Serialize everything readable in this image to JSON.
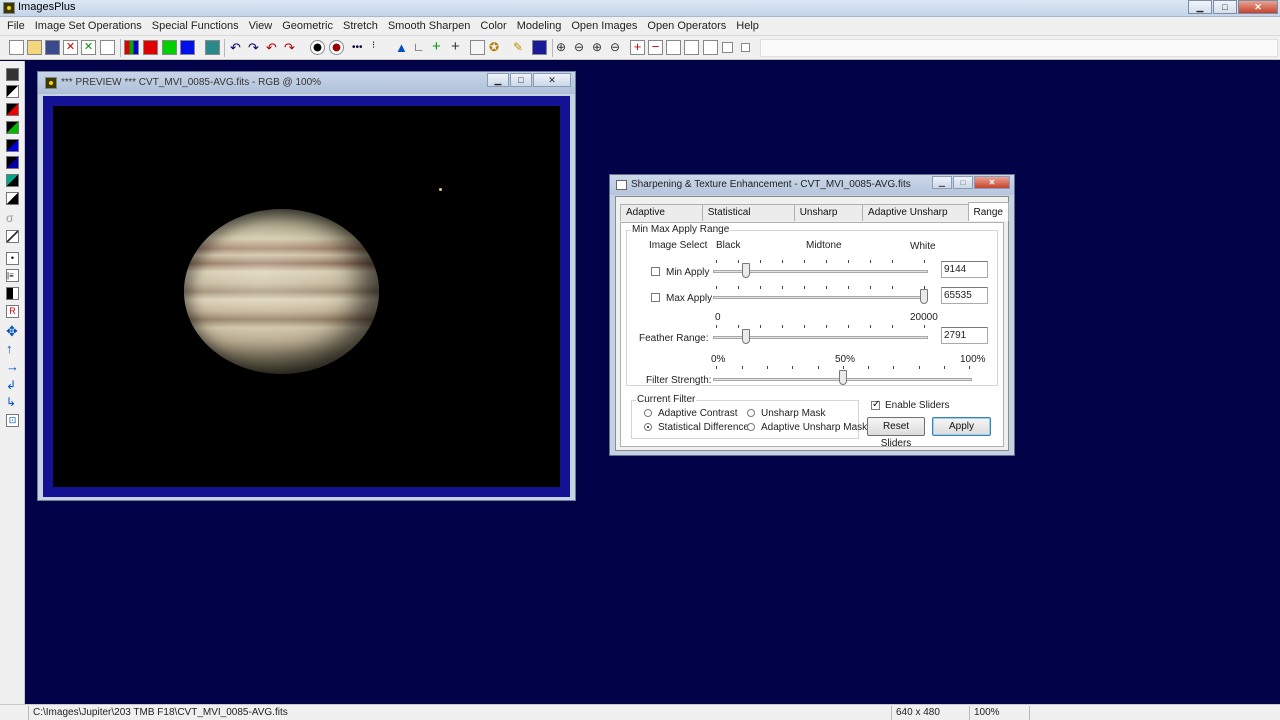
{
  "app": {
    "title": "ImagesPlus"
  },
  "menu": [
    "File",
    "Image Set Operations",
    "Special Functions",
    "View",
    "Geometric",
    "Stretch",
    "Smooth Sharpen",
    "Color",
    "Modeling",
    "Open Images",
    "Open Operators",
    "Help"
  ],
  "preview": {
    "title": "*** PREVIEW *** CVT_MVI_0085-AVG.fits - RGB @ 100%"
  },
  "dialog": {
    "title": "Sharpening & Texture Enhancement - CVT_MVI_0085-AVG.fits",
    "tabs": [
      "Adaptive Contrast",
      "Statistical Difference",
      "Unsharp Mask",
      "Adaptive Unsharp Mask",
      "Range"
    ],
    "active_tab": "Range",
    "range_group": {
      "label": "Min Max Apply Range",
      "image_select_label": "Image Select",
      "black_label": "Black",
      "midtone_label": "Midtone",
      "white_label": "White",
      "min_apply": {
        "label": "Min Apply",
        "checked": false,
        "value": "9144"
      },
      "max_apply": {
        "label": "Max Apply",
        "checked": false,
        "value": "65535"
      },
      "scale_min": "0",
      "scale_max": "20000",
      "feather": {
        "label": "Feather Range:",
        "value": "2791"
      }
    },
    "filter_strength": {
      "label": "Filter Strength:",
      "p0": "0%",
      "p50": "50%",
      "p100": "100%",
      "level": 0.5
    },
    "current_filter": {
      "label": "Current Filter",
      "options": [
        "Adaptive Contrast",
        "Unsharp Mask",
        "Statistical Difference",
        "Adaptive Unsharp Mask"
      ],
      "selected": "Statistical Difference"
    },
    "enable_sliders": {
      "label": "Enable Sliders",
      "checked": true
    },
    "reset_button": "Reset Sliders",
    "apply_button": "Apply"
  },
  "status": {
    "path": "C:\\Images\\Jupiter\\203 TMB F18\\CVT_MVI_0085-AVG.fits",
    "dims": "640 x 480",
    "zoom": "100%"
  }
}
